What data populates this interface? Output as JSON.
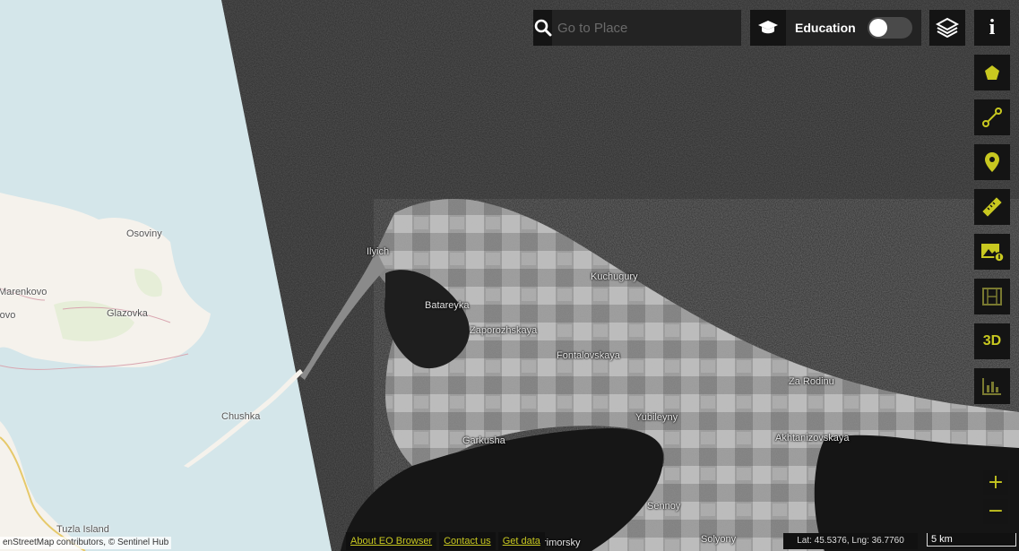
{
  "search": {
    "placeholder": "Go to Place",
    "icon": "search-icon"
  },
  "education": {
    "label": "Education",
    "enabled": false
  },
  "toolbar": {
    "info_label": "i",
    "tools": [
      {
        "name": "polygon-icon"
      },
      {
        "name": "line-measure-icon"
      },
      {
        "name": "location-pin-icon"
      },
      {
        "name": "ruler-icon"
      },
      {
        "name": "image-download-icon"
      },
      {
        "name": "timelapse-film-icon"
      },
      {
        "name": "3d-label",
        "label": "3D"
      },
      {
        "name": "histogram-icon"
      }
    ],
    "zoom_in": "+",
    "zoom_out": "−"
  },
  "places": {
    "osoviny": "Osoviny",
    "marenkovo": "Marenkovo",
    "ovo": "rovo",
    "glazovka": "Glazovka",
    "chushka": "Chushka",
    "tuzla": "Tuzla Island",
    "ilyich": "Ilyich",
    "batareyka": "Batareyka",
    "zaporozhskaya": "Zaporozhskaya",
    "kuchugury": "Kuchugury",
    "fontalovskaya": "Fontalovskaya",
    "za_rodinu": "Za Rodinu",
    "yubileyny": "Yubileyny",
    "garkusha": "Garkusha",
    "akhtanizovskaya": "Akhtanizovskaya",
    "sennoy": "Sennoy",
    "primorsky": "rimorsky",
    "solyony": "Solyony"
  },
  "footer": {
    "about": "About EO Browser",
    "contact": "Contact us",
    "data": "Get data"
  },
  "attribution": "enStreetMap contributors, © Sentinel Hub",
  "coordinates": "Lat: 45.5376, Lng: 36.7760",
  "scale": "5 km",
  "colors": {
    "accent": "#c8c820",
    "sea_osm": "#d4e6ea",
    "land_osm": "#f5f2ec",
    "sar_sea": "#2a2a2a"
  }
}
